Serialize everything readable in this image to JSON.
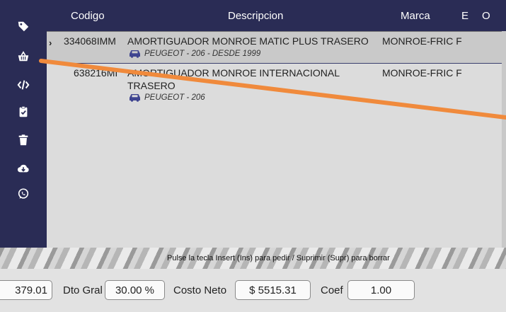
{
  "sidebar": {
    "icons": [
      "tag-icon",
      "basket-icon",
      "code-icon",
      "clipboard-check-icon",
      "trash-icon",
      "cloud-download-icon",
      "whatsapp-icon"
    ]
  },
  "table": {
    "columns": [
      "Codigo",
      "Descripcion",
      "Marca",
      "E",
      "O"
    ],
    "rows": [
      {
        "codigo": "334068IMM",
        "descripcion": "AMORTIGUADOR MONROE MATIC PLUS TRASERO",
        "descripcion2": "",
        "marca": "MONROE-FRIC F",
        "vehiculo": "PEUGEOT - 206  - DESDE 1999"
      },
      {
        "codigo": "638216MI",
        "descripcion": "AMORTIGUADOR MONROE INTERNACIONAL",
        "descripcion2": "TRASERO",
        "marca": "MONROE-FRIC F",
        "vehiculo": "PEUGEOT - 206"
      }
    ]
  },
  "hint": "Pulse la tecla Insert (Ins) para pedir / Suprimir (Supr) para borrar",
  "footer": {
    "left_value": "379.01",
    "dto_label": "Dto Gral",
    "dto_value": "30.00 %",
    "costo_label": "Costo Neto",
    "costo_value": "$ 5515.31",
    "coef_label": "Coef",
    "coef_value": "1.00"
  },
  "colors": {
    "sidebar": "#2a2c55",
    "annotation_line": "#f08a3c"
  }
}
